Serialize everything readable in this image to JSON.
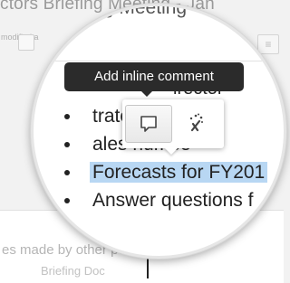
{
  "background": {
    "title_fragment": "ctors Briefing Meeting - Jan",
    "subtitle_fragment": "modified a",
    "note_fragment": "es made by other peop",
    "note_fragment_2": "Briefing Doc"
  },
  "document": {
    "heading_fragment": "irector",
    "bullets": [
      {
        "text": "trategy",
        "selected": false
      },
      {
        "text": "ales numbe",
        "selected": false
      },
      {
        "text": "Forecasts for FY201",
        "selected": true
      },
      {
        "text": "Answer questions f",
        "selected": false
      }
    ]
  },
  "tooltip": {
    "label": "Add inline comment"
  },
  "popup": {
    "comment_icon": "speech-bubble-icon",
    "assist_icon": "magic-wand-icon"
  },
  "colors": {
    "selection": "#b8d7f3",
    "tooltip_bg": "#2b2b2b"
  }
}
